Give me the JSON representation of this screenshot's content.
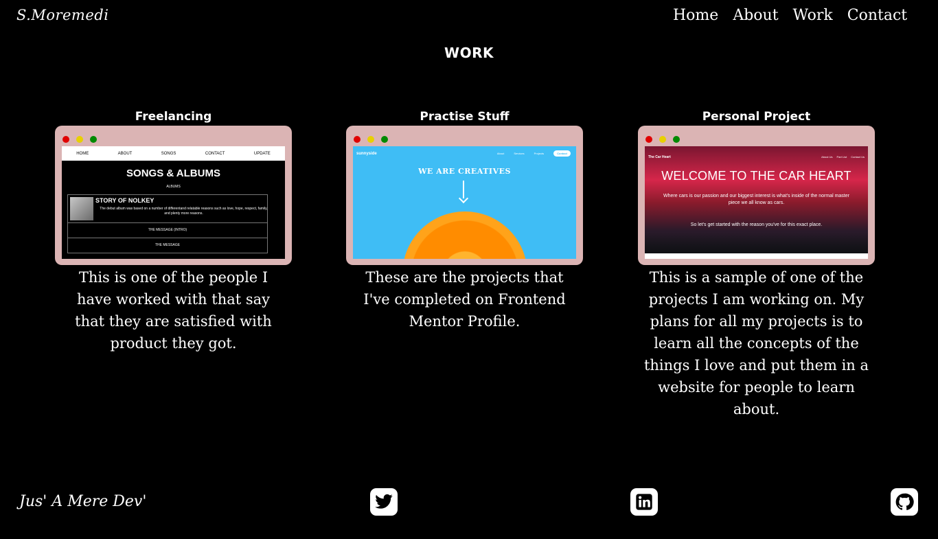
{
  "header": {
    "logo": "S.Moremedi",
    "nav": [
      "Home",
      "About",
      "Work",
      "Contact"
    ]
  },
  "page_title": "WORK",
  "cards": [
    {
      "title": "Freelancing",
      "description": "This is one of the people I have worked with that say that they are satisfied with product they got.",
      "screenshot": {
        "nav": [
          "HOME",
          "ABOUT",
          "SONGS",
          "CONTACT",
          "UPDATE"
        ],
        "headline": "SONGS & ALBUMS",
        "subheading": "ALBUMS",
        "story_title": "STORY OF NOLKEY",
        "story_text": "The debut album was based on a number of differentand relatable reasons such as love, hope, respect, family, and plenty more reasons.",
        "rows": [
          "THE MESSAGE (INTRO)",
          "THE MESSAGE"
        ]
      }
    },
    {
      "title": "Practise Stuff",
      "description": "These are the projects that I've completed on Frontend Mentor Profile.",
      "screenshot": {
        "brand": "sunnyside",
        "links": [
          "About",
          "Services",
          "Projects",
          "Contact"
        ],
        "headline": "WE ARE CREATIVES"
      }
    },
    {
      "title": "Personal Project",
      "description": "This is a sample of one of the projects I am working on. My plans for all my projects is to learn all the concepts of the things I love and put them in a website for people to learn about.",
      "screenshot": {
        "brand": "The Car Heart",
        "links": [
          "About Us",
          "Part List",
          "Contact Us"
        ],
        "headline": "WELCOME TO THE CAR HEART",
        "tagline": "Where cars is our passion and our biggest interest is what's inside of the normal master piece we all know as cars.",
        "cta": "So let's get started with the reason you've for this exact place."
      }
    }
  ],
  "footer": {
    "text": "Jus' A Mere Dev'",
    "social_icons": [
      "twitter-icon",
      "linkedin-icon",
      "github-icon"
    ]
  },
  "colors": {
    "background": "#000000",
    "frame": "#dbb4b4",
    "window_dot_red": "#e00000",
    "window_dot_yellow": "#e8d000",
    "window_dot_green": "#008a00"
  }
}
